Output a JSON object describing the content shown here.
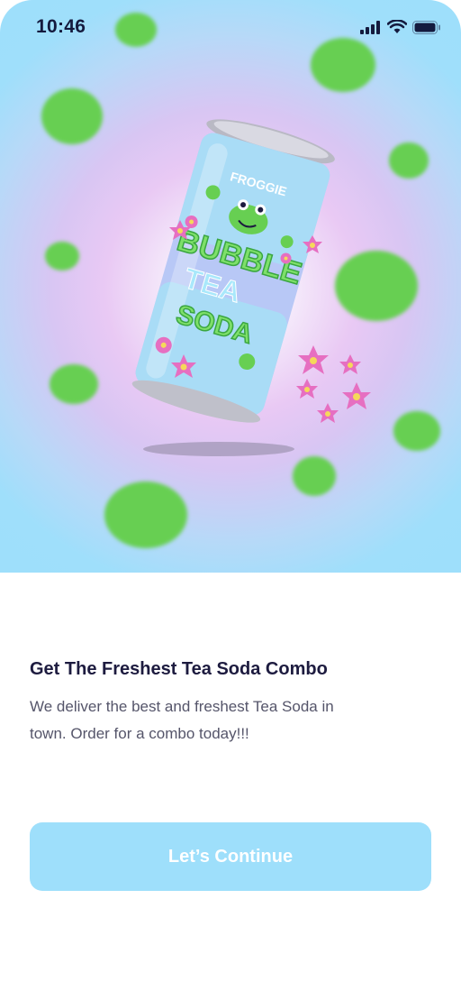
{
  "status_bar": {
    "time": "10:46",
    "icons": [
      "signal-icon",
      "wifi-icon",
      "battery-icon"
    ]
  },
  "hero": {
    "product_brand": "FROGGIE",
    "product_name_lines": [
      "BUBBLE",
      "TEA",
      "SODA"
    ],
    "colors": {
      "sky": "#9edffb",
      "glow": "#e9c9f4",
      "lily_pad": "#67cf52",
      "can": "#b7c7f3",
      "lotus": "#e66fc1"
    }
  },
  "onboarding": {
    "title": "Get The Freshest Tea Soda Combo",
    "description": "We deliver the best and freshest Tea Soda in town. Order for a combo today!!!",
    "continue_button": "Let’s Continue"
  },
  "colors": {
    "primary": "#9edffb",
    "title_text": "#1d1b3f",
    "body_text": "#55556a"
  }
}
